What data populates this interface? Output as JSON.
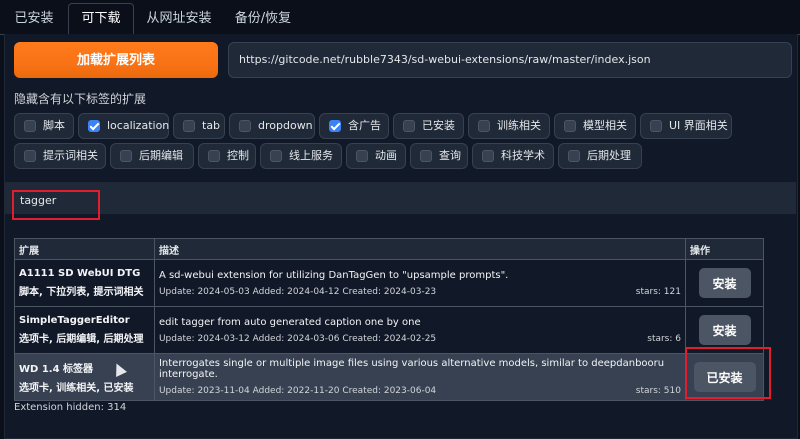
{
  "tabs": [
    {
      "label": "已安装"
    },
    {
      "label": "可下载"
    },
    {
      "label": "从网址安装"
    },
    {
      "label": "备份/恢复"
    }
  ],
  "active_tab": "可下载",
  "load_button": {
    "label": "加载扩展列表"
  },
  "url_input": {
    "value": "https://gitcode.net/rubble7343/sd-webui-extensions/raw/master/index.json"
  },
  "filter": {
    "title": "隐藏含有以下标签的扩展",
    "tags": [
      {
        "label": "脚本",
        "checked": false
      },
      {
        "label": "localization",
        "checked": true
      },
      {
        "label": "tab",
        "checked": false
      },
      {
        "label": "dropdown",
        "checked": false
      },
      {
        "label": "含广告",
        "checked": true
      },
      {
        "label": "已安装",
        "checked": false
      },
      {
        "label": "训练相关",
        "checked": false
      },
      {
        "label": "模型相关",
        "checked": false
      },
      {
        "label": "UI 界面相关",
        "checked": false
      },
      {
        "label": "提示词相关",
        "checked": false
      },
      {
        "label": "后期编辑",
        "checked": false
      },
      {
        "label": "控制",
        "checked": false
      },
      {
        "label": "线上服务",
        "checked": false
      },
      {
        "label": "动画",
        "checked": false
      },
      {
        "label": "查询",
        "checked": false
      },
      {
        "label": "科技学术",
        "checked": false
      },
      {
        "label": "后期处理",
        "checked": false
      }
    ]
  },
  "search": {
    "value": "tagger"
  },
  "table": {
    "headers": {
      "extension": "扩展",
      "description": "描述",
      "action": "操作"
    },
    "rows": [
      {
        "name": "A1111 SD WebUI DTG",
        "tags": "脚本, 下拉列表, 提示词相关",
        "description": "A sd-webui extension for utilizing DanTagGen to \"upsample prompts\".",
        "meta": "Update: 2024-05-03 Added: 2024-04-12 Created: 2024-03-23",
        "stars": "stars: 121",
        "action": "安装"
      },
      {
        "name": "SimpleTaggerEditor",
        "tags": "选项卡, 后期编辑, 后期处理",
        "description": "edit tagger from auto generated caption one by one",
        "meta": "Update: 2024-03-12 Added: 2024-03-06 Created: 2024-02-25",
        "stars": "stars: 6",
        "action": "安装"
      },
      {
        "name": "WD 1.4 标签器",
        "tags": "选项卡, 训练相关, 已安装",
        "description": "Interrogates single or multiple image files using various alternative models, similar to deepdanbooru interrogate.",
        "meta": "Update: 2023-11-04 Added: 2022-11-20 Created: 2023-06-04",
        "stars": "stars: 510",
        "action": "已安装"
      }
    ]
  },
  "footer": {
    "hidden_text": "Extension hidden: 314"
  },
  "colors": {
    "accent": "#f97316",
    "highlight": "#e11d2e",
    "checkbox": "#3b82f6",
    "background": "#0b0f19"
  }
}
